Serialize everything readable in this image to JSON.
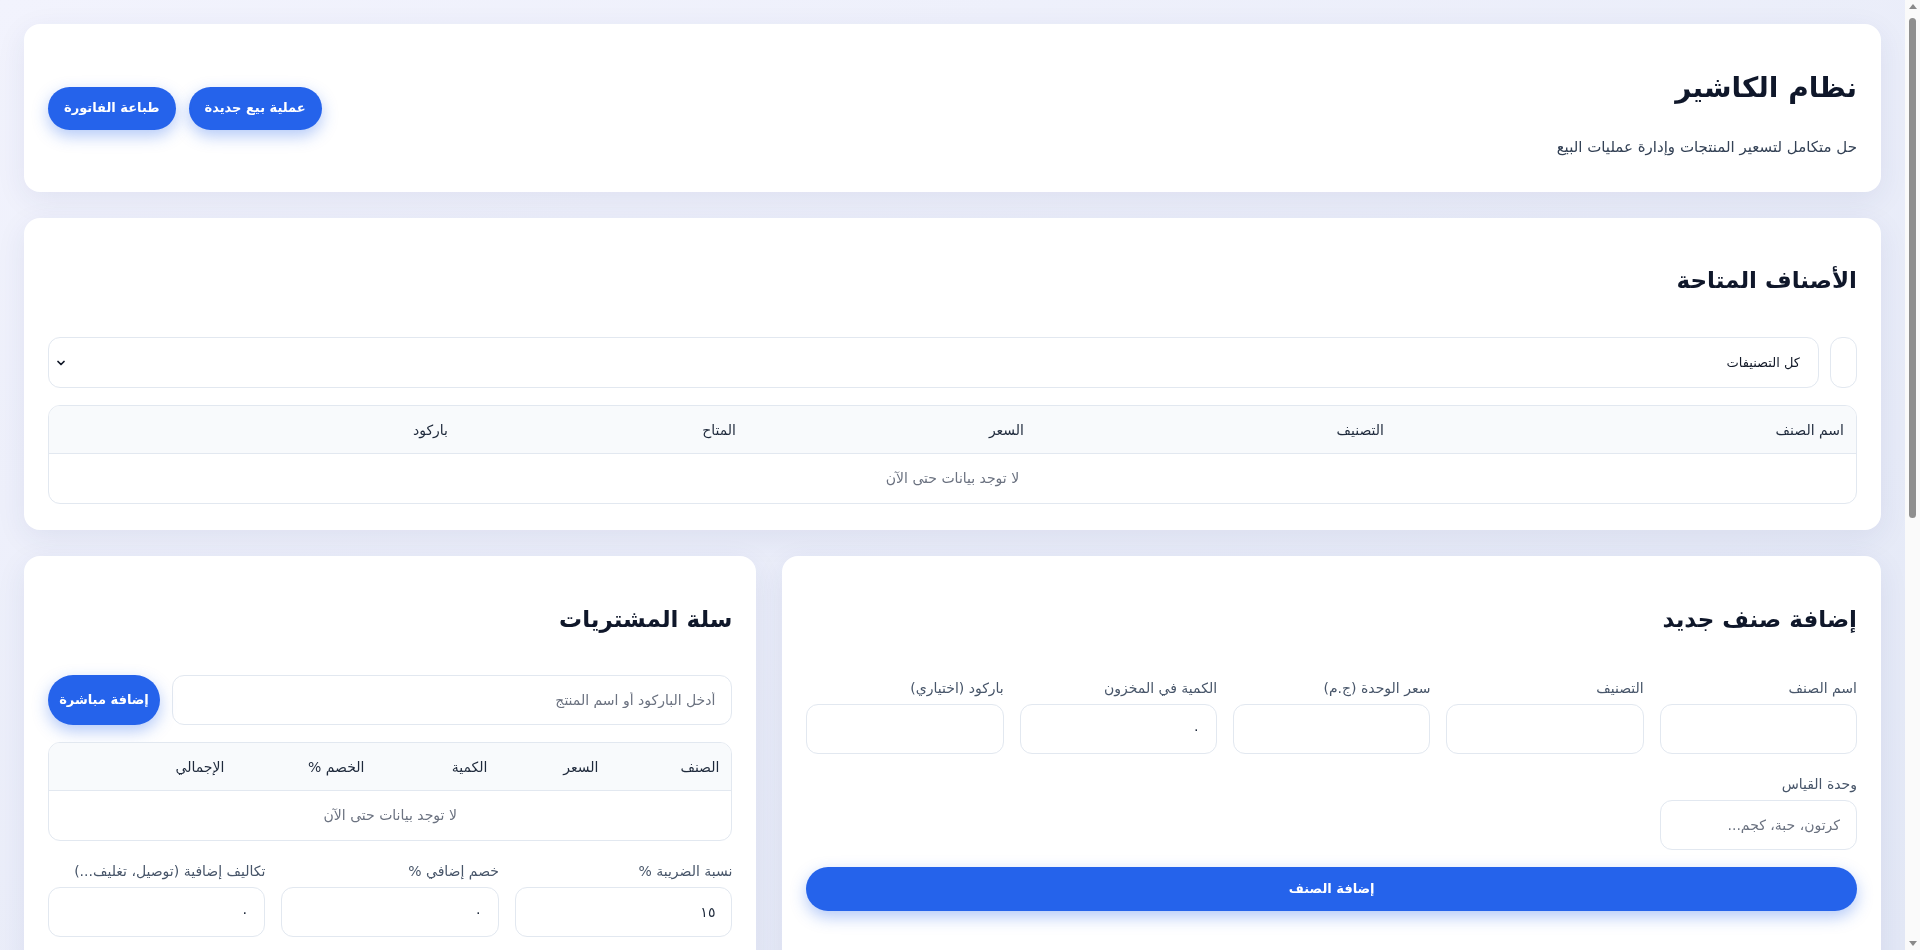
{
  "header": {
    "title": "نظام الكاشير",
    "subtitle": "حل متكامل لتسعير المنتجات وإدارة عمليات البيع",
    "buttons": [
      {
        "label": "عملية بيع جديدة"
      },
      {
        "label": "طباعة الفاتورة"
      }
    ]
  },
  "products": {
    "title": "الأصناف المتاحة",
    "category_filter": {
      "value": "كل التصنيفات"
    },
    "table": {
      "columns": [
        "اسم الصنف",
        "التصنيف",
        "السعر",
        "المتاح",
        "باركود"
      ],
      "empty_message": "لا توجد بيانات حتى الآن"
    }
  },
  "new_item": {
    "title": "إضافة صنف جديد",
    "fields": [
      {
        "label": "اسم الصنف"
      },
      {
        "label": "التصنيف"
      },
      {
        "label": "سعر الوحدة (ج.م)"
      },
      {
        "label": "الكمية في المخزون",
        "value": "٠"
      },
      {
        "label": "باركود (اختياري)"
      },
      {
        "label": "وحدة القياس",
        "placeholder": "كرتون، حبة، كجم..."
      }
    ],
    "submit": "إضافة الصنف"
  },
  "cart": {
    "title": "سلة المشتريات",
    "search": {
      "placeholder": "أدخل الباركود أو اسم المنتج"
    },
    "add_button": "إضافة مباشرة",
    "table": {
      "columns": [
        "الصنف",
        "السعر",
        "الكمية",
        "الخصم %",
        "الإجمالي"
      ],
      "empty_message": "لا توجد بيانات حتى الآن"
    },
    "fields": [
      {
        "label": "نسبة الضريبة %",
        "value": "١٥"
      },
      {
        "label": "خصم إضافي %",
        "value": "٠"
      },
      {
        "label": "تكاليف إضافية (توصيل، تغليف...)",
        "value": "٠"
      }
    ]
  }
}
